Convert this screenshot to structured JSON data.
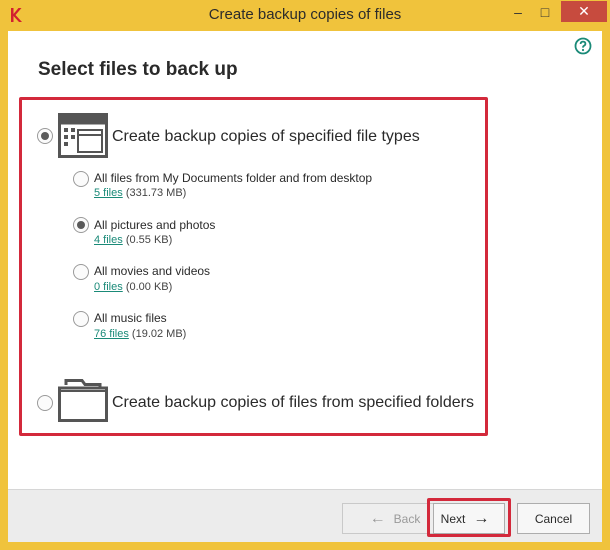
{
  "window": {
    "title": "Create backup copies of files",
    "controls": {
      "minimize": "–",
      "maximize": "□",
      "close": "✕"
    }
  },
  "page": {
    "heading": "Select files to back up",
    "help_icon": "question-circle-icon"
  },
  "mode": {
    "file_types_label": "Create backup copies of specified file types",
    "file_types_selected": true,
    "folders_label": "Create backup copies of files from specified folders",
    "folders_selected": false
  },
  "options": [
    {
      "label": "All files from My Documents folder and from desktop",
      "link": "5 files",
      "size": "(331.73 MB)",
      "selected": false
    },
    {
      "label": "All pictures and photos",
      "link": "4 files",
      "size": "(0.55 KB)",
      "selected": true
    },
    {
      "label": "All movies and videos",
      "link": "0 files",
      "size": "(0.00 KB)",
      "selected": false
    },
    {
      "label": "All music files",
      "link": "76 files",
      "size": "(19.02 MB)",
      "selected": false
    }
  ],
  "footer": {
    "back_label": "Back",
    "back_arrow": "←",
    "next_label": "Next",
    "next_arrow": "→",
    "cancel_label": "Cancel"
  },
  "colors": {
    "titlebar": "#f0c33c",
    "highlight": "#d3293b",
    "link": "#1a8a78",
    "help": "#1a8a78"
  }
}
